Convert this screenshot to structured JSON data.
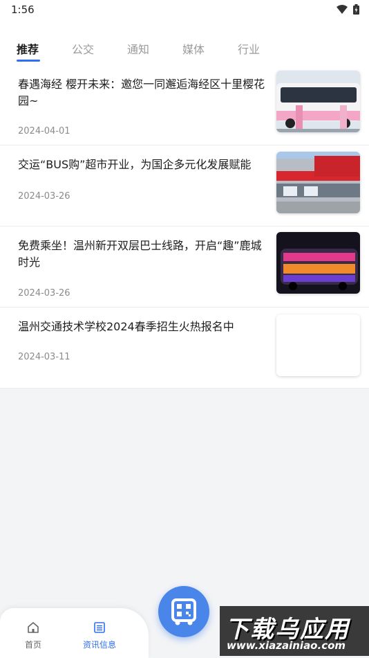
{
  "status_bar": {
    "time": "1:56"
  },
  "tabs": [
    {
      "label": "推荐"
    },
    {
      "label": "公交"
    },
    {
      "label": "通知"
    },
    {
      "label": "媒体"
    },
    {
      "label": "行业"
    }
  ],
  "news": [
    {
      "title": "春遇海经 樱开未来：邀您一同邂逅海经区十里樱花园~",
      "date": "2024-04-01"
    },
    {
      "title": "交运“BUS购”超市开业，为国企多元化发展赋能",
      "date": "2024-03-26"
    },
    {
      "title": "免费乘坐！温州新开双层巴士线路，开启“趣”鹿城时光",
      "date": "2024-03-26"
    },
    {
      "title": "温州交通技术学校2024春季招生火热报名中",
      "date": "2024-03-11"
    }
  ],
  "bottom_nav": {
    "home_label": "首页",
    "news_label": "资讯信息"
  },
  "watermark": {
    "main": "下载乌应用",
    "url": "www.xiazainiao.com"
  },
  "colors": {
    "accent": "#2f6ef1",
    "fab": "#4a86ea",
    "background": "#f3f4f6"
  }
}
